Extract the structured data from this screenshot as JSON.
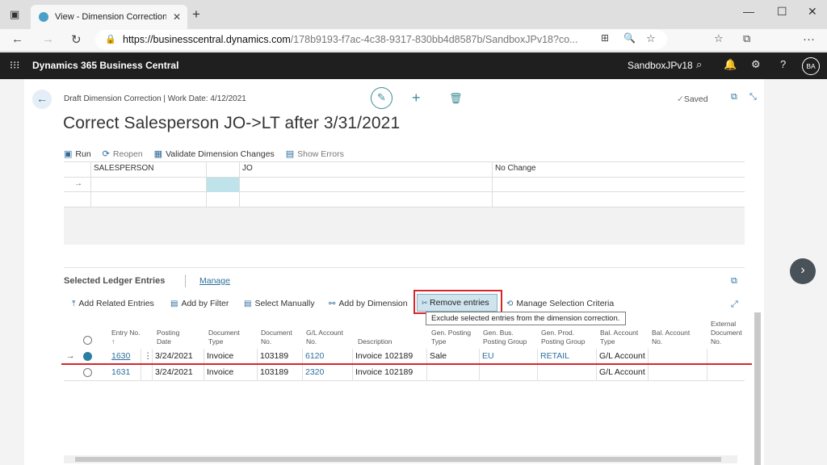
{
  "browser": {
    "tab_title": "View - Dimension Corrections - D",
    "url_host": "https://businesscentral.dynamics.com",
    "url_rest": "/178b9193-f7ac-4c38-9317-830bb4d8587b/SandboxJPv18?co..."
  },
  "app": {
    "name": "Dynamics 365 Business Central",
    "environment": "SandboxJPv18",
    "avatar_initials": "BA"
  },
  "page": {
    "breadcrumb": "Draft Dimension Correction | Work Date: 4/12/2021",
    "saved_status": "Saved",
    "title": "Correct Salesperson JO->LT after 3/31/2021"
  },
  "toolbar": {
    "run": "Run",
    "reopen": "Reopen",
    "validate": "Validate Dimension Changes",
    "show_errors": "Show Errors"
  },
  "dimension_grid": {
    "row1": {
      "code": "SALESPERSON",
      "value": "JO",
      "change": "No Change"
    },
    "row2_marker": "→"
  },
  "ledger": {
    "section_title": "Selected Ledger Entries",
    "manage_label": "Manage",
    "actions": {
      "add_related": "Add Related Entries",
      "add_filter": "Add by Filter",
      "select_manually": "Select Manually",
      "add_dimension": "Add by Dimension",
      "remove_entries": "Remove entries",
      "manage_criteria": "Manage Selection Criteria"
    },
    "tooltip": "Exclude selected entries from the dimension correction.",
    "headers": {
      "entry_no": "Entry No. ↑",
      "posting_date": "Posting Date",
      "document_type": "Document Type",
      "document_no": "Document No.",
      "gl_account_no": "G/L Account No.",
      "description": "Description",
      "gen_posting_type": "Gen. Posting Type",
      "gen_bus_posting_group": "Gen. Bus. Posting Group",
      "gen_prod_posting_group": "Gen. Prod. Posting Group",
      "bal_account_type": "Bal. Account Type",
      "bal_account_no": "Bal. Account No.",
      "external_document_no": "External Document No."
    },
    "rows": [
      {
        "marker": "→",
        "entry_no": "1630",
        "posting_date": "3/24/2021",
        "document_type": "Invoice",
        "document_no": "103189",
        "gl_account_no": "6120",
        "description": "Invoice 102189",
        "gen_posting_type": "Sale",
        "gen_bus_posting_group": "EU",
        "gen_prod_posting_group": "RETAIL",
        "bal_account_type": "G/L Account",
        "bal_account_no": "",
        "external_document_no": ""
      },
      {
        "marker": "",
        "entry_no": "1631",
        "posting_date": "3/24/2021",
        "document_type": "Invoice",
        "document_no": "103189",
        "gl_account_no": "2320",
        "description": "Invoice 102189",
        "gen_posting_type": "",
        "gen_bus_posting_group": "",
        "gen_prod_posting_group": "",
        "bal_account_type": "G/L Account",
        "bal_account_no": "",
        "external_document_no": ""
      }
    ]
  }
}
